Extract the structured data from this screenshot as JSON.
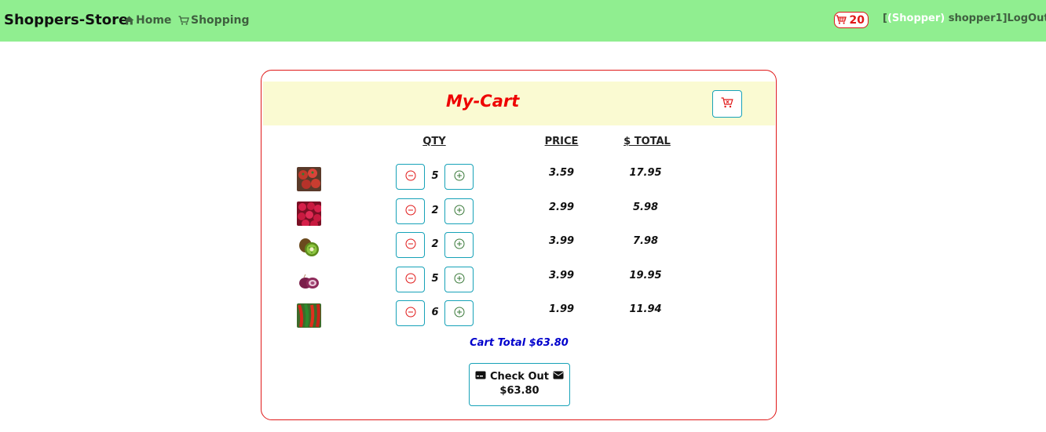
{
  "brand": "Shoppers-Store",
  "nav": {
    "home_label": "Home",
    "shopping_label": "Shopping"
  },
  "header": {
    "cart_count": "20",
    "user_open": "[",
    "user_role": "(Shopper)",
    "user_name": " shopper1]",
    "logout_label": "LogOut"
  },
  "cart": {
    "title": "My-Cart",
    "columns": {
      "qty": "QTY",
      "price": "PRICE",
      "total": "$ TOTAL"
    },
    "items": [
      {
        "image": "tomatoes-image",
        "qty": "5",
        "price": "3.59",
        "total": "17.95"
      },
      {
        "image": "raspberries-image",
        "qty": "2",
        "price": "2.99",
        "total": "5.98"
      },
      {
        "image": "kiwi-image",
        "qty": "2",
        "price": "3.99",
        "total": "7.98"
      },
      {
        "image": "red-onion-image",
        "qty": "5",
        "price": "3.99",
        "total": "19.95"
      },
      {
        "image": "chili-peppers-image",
        "qty": "6",
        "price": "1.99",
        "total": "11.94"
      }
    ],
    "cart_total": "Cart Total $63.80",
    "checkout_label": "Check Out",
    "checkout_amount": "$63.80"
  },
  "colors": {
    "navbar": "#90ee90",
    "accent_red": "#e01818",
    "button_border": "#17a2b8",
    "cart_header_bg": "#fafad2",
    "cart_total": "#0000cc"
  }
}
